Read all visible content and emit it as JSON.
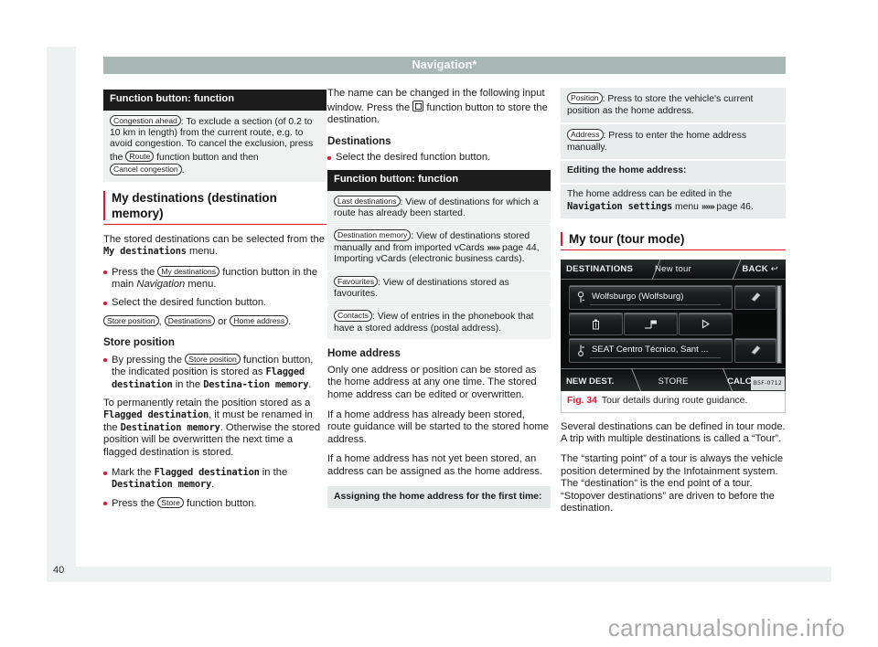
{
  "page": {
    "banner_title": "Navigation*",
    "folio": "40",
    "watermark": "carmanualsonline.info"
  },
  "col1": {
    "fb_table": {
      "header": "Function button: function",
      "rows": [
        {
          "key": "Congestion ahead",
          "text_a": ": To exclude a section (of 0.2 to 10 km in length) from the current route, e.g. to avoid congestion. To cancel the exclusion, press the ",
          "key2": "Route",
          "text_b": " function button and then ",
          "key3": "Cancel congestion",
          "text_c": "."
        }
      ]
    },
    "heading": "My destinations (destination memory)",
    "p1_a": "The stored destinations can be selected from the ",
    "p1_mono": "My destinations",
    "p1_b": " menu.",
    "b1_a": "Press the ",
    "b1_key": "My destinations",
    "b1_b": " function button in the main ",
    "b1_i": "Navigation",
    "b1_c": " menu.",
    "b2": "Select the desired function button.",
    "b2_key1": "Store position",
    "b2_sep1": ", ",
    "b2_key2": "Destinations",
    "b2_sep2": " or ",
    "b2_key3": "Home address",
    "b2_end": ".",
    "subhead_store": "Store position",
    "b3_a": "By pressing the ",
    "b3_key": "Store position",
    "b3_b": " function button, the indicated position is stored as ",
    "b3_mono1": "Flagged destination",
    "b3_c": " in the ",
    "b3_mono2": "Destina-tion memory",
    "b3_d": ".",
    "p2_a": "To permanently retain the position stored as a ",
    "p2_mono1": "Flagged destination",
    "p2_b": ", it must be renamed in the ",
    "p2_mono2": "Destination memory",
    "p2_c": ". Otherwise the stored position will be overwritten the next time a flagged destination is stored.",
    "b4_a": "Mark the ",
    "b4_mono1": "Flagged destination",
    "b4_b": " in the ",
    "b4_mono2": "Destination memory",
    "b4_c": ".",
    "b5_a": "Press the ",
    "b5_key": "Store",
    "b5_b": " function button."
  },
  "col2": {
    "p1_a": "The name can be changed in the following input window. Press the ",
    "p1_icon": "store-icon",
    "p1_b": " function button to store the destination.",
    "subhead_destinations": "Destinations",
    "b1": "Select the desired function button.",
    "fb_table": {
      "header": "Function button: function",
      "rows": [
        {
          "key": "Last destinations",
          "text": ": View of destinations for which a route has already been started."
        },
        {
          "key": "Destination memory",
          "text": ": View of destinations stored manually and from imported vCards ",
          "ref": "»»»",
          "text2": " page 44, Importing vCards (electronic business cards)."
        },
        {
          "key": "Favourites",
          "text": ": View of destinations stored as favourites."
        },
        {
          "key": "Contacts",
          "text": ": View of entries in the phonebook that have a stored address (postal address)."
        }
      ]
    },
    "subhead_home": "Home address",
    "p2": "Only one address or position can be stored as the home address at any one time. The stored home address can be edited or overwritten.",
    "p3": "If a home address has already been stored, route guidance will be started to the stored home address.",
    "p4": "If a home address has not yet been stored, an address can be assigned as the home address.",
    "greybar": "Assigning the home address for the first time:"
  },
  "col3": {
    "box1_key": "Position",
    "box1_text": ": Press to store the vehicle's current position as the home address.",
    "box2_key": "Address",
    "box2_text": ": Press to enter the home address manually.",
    "box3_title": "Editing the home address:",
    "box4_a": "The home address can be edited in the ",
    "box4_mono": "Navigation settings",
    "box4_b": " menu ",
    "box4_ref": "»»»",
    "box4_c": " page 46.",
    "heading": "My tour (tour mode)",
    "nav_screen": {
      "top_left": "DESTINATIONS",
      "top_center": "New tour",
      "top_right": "BACK",
      "back_arrow": "↩",
      "dest_start": "Wolfsburgo (Wolfsburg)",
      "dest_end": "SEAT Centro Técnico, Sant ...",
      "icon_start": "start-flag-icon",
      "icon_end": "destination-flag-icon",
      "icon_edit": "edit-icon",
      "icon_delete": "trash-icon",
      "icon_stopover": "add-stopover-icon",
      "icon_play": "play-icon",
      "bottom_left": "NEW DEST.",
      "bottom_center": "STORE",
      "bottom_right": "CALCULATE",
      "code": "B5F-0712"
    },
    "fig_no": "Fig. 34",
    "fig_caption": "Tour details during route guidance.",
    "p1": "Several destinations can be defined in tour mode. A trip with multiple destinations is called a “Tour”.",
    "p2": "The “starting point” of a tour is always the vehicle position determined by the Infotainment system. The “destination” is the end point of a tour. “Stopover destinations” are driven to before the destination."
  }
}
